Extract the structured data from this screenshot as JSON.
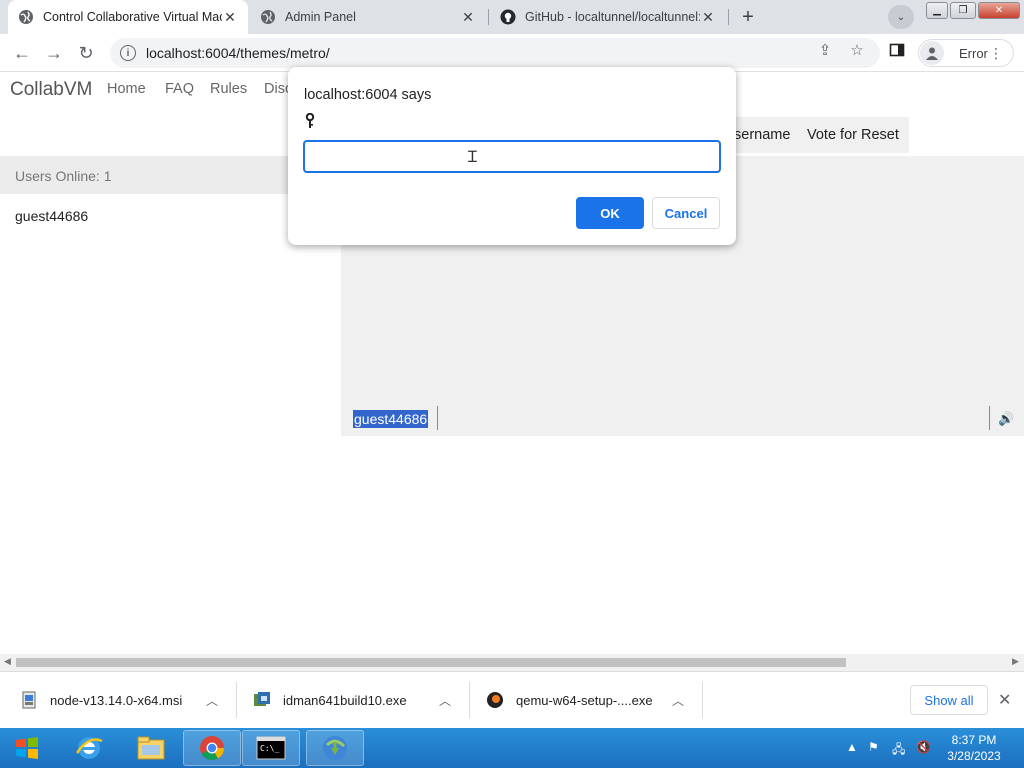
{
  "browser": {
    "tabs": [
      {
        "title": "Control Collaborative Virtual Mac",
        "active": true,
        "icon": "globe-icon"
      },
      {
        "title": "Admin Panel",
        "active": false,
        "icon": "globe-icon"
      },
      {
        "title": "GitHub - localtunnel/localtunnel:",
        "active": false,
        "icon": "github-icon"
      }
    ],
    "url": "localhost:6004/themes/metro/",
    "error_button": "Error"
  },
  "site": {
    "brand": "CollabVM",
    "nav": [
      "Home",
      "FAQ",
      "Rules",
      "Disc"
    ],
    "buttons": [
      "sername",
      "Vote for Reset"
    ],
    "users_online": "Users Online: 1",
    "users": [
      "guest44686"
    ],
    "vm_user": "guest44686"
  },
  "dialog": {
    "title": "localhost:6004 says",
    "message": "🔑",
    "input_value": "",
    "ok": "OK",
    "cancel": "Cancel"
  },
  "downloads": [
    {
      "name": "node-v13.14.0-x64.msi",
      "icon": "msi-package-icon"
    },
    {
      "name": "idman641build10.exe",
      "icon": "exe-installer-icon"
    },
    {
      "name": "qemu-w64-setup-....exe",
      "icon": "qemu-icon"
    }
  ],
  "downloads_show_all": "Show all",
  "taskbar": {
    "time": "8:37 PM",
    "date": "3/28/2023"
  },
  "colors": {
    "accent": "#1a73e8",
    "taskbar": "#1b6fbf",
    "selection": "#3366cc"
  }
}
